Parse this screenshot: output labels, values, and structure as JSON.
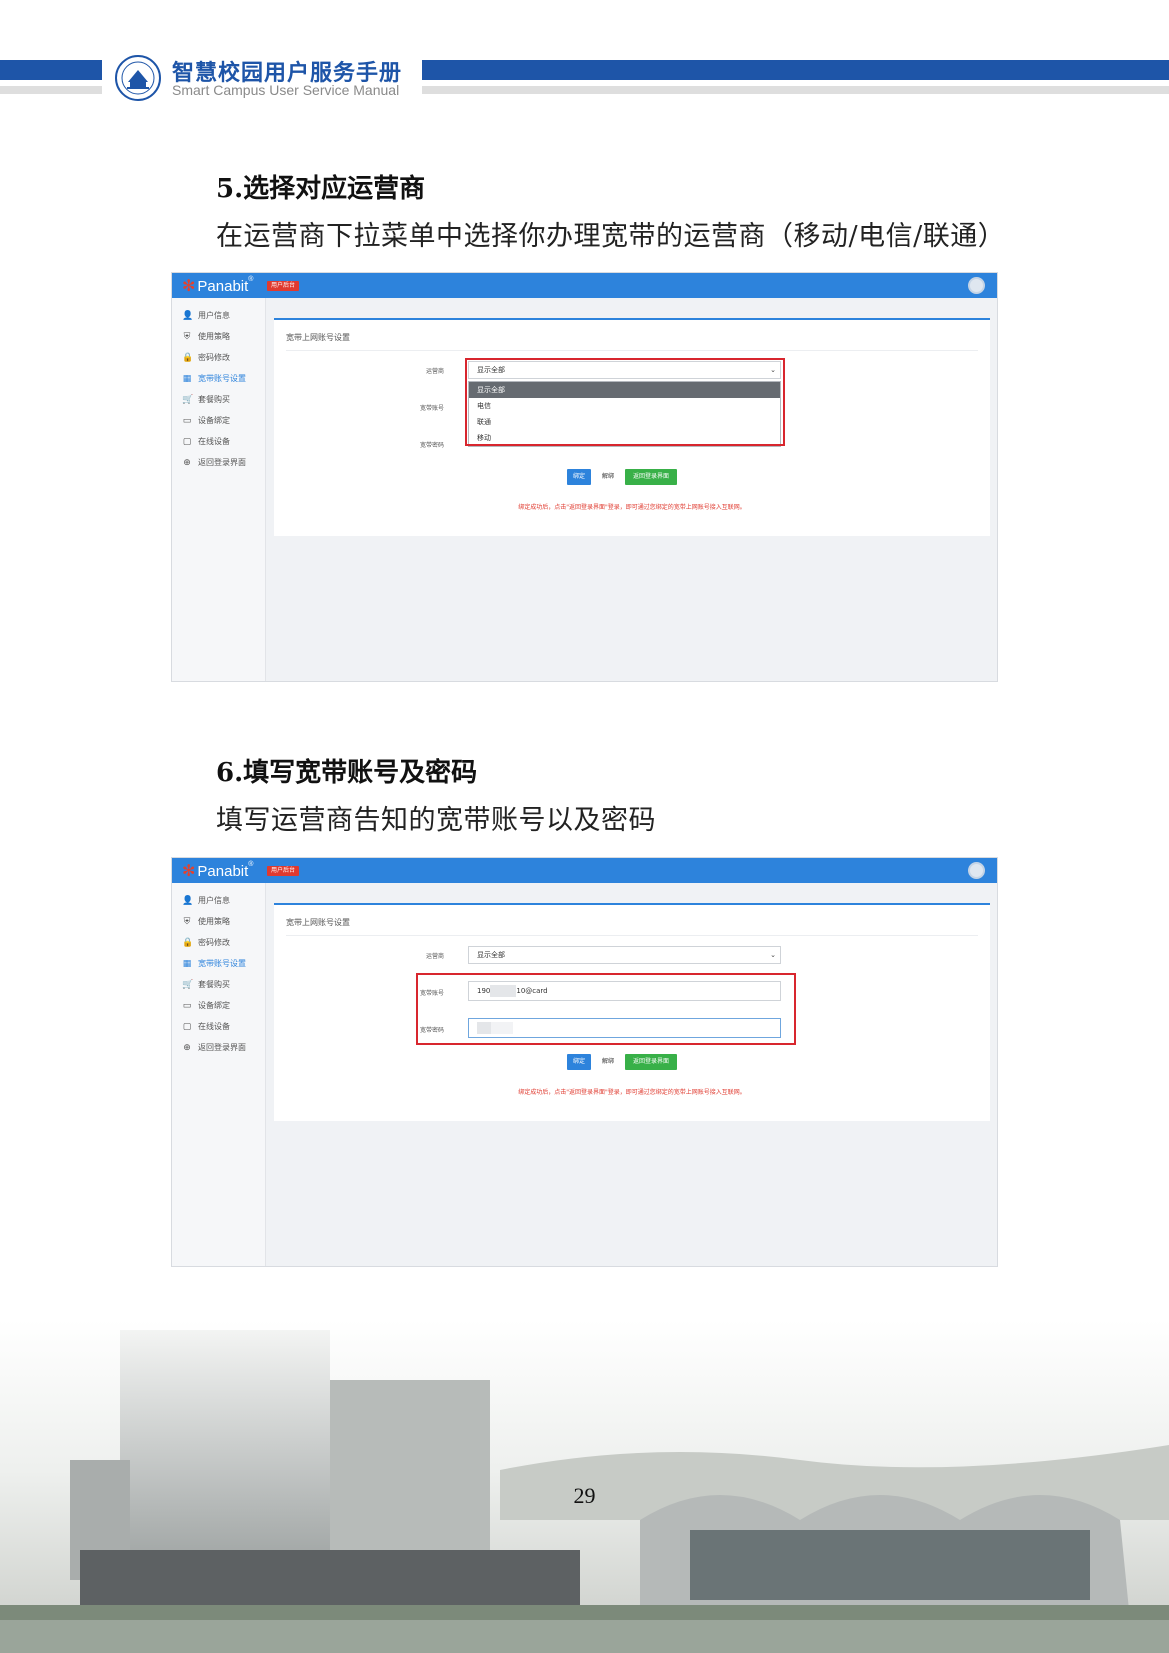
{
  "header": {
    "title": "智慧校园用户服务手册",
    "subtitle": "Smart Campus User Service Manual"
  },
  "section5": {
    "title": "5.选择对应运营商",
    "desc": "在运营商下拉菜单中选择你办理宽带的运营商（移动/电信/联通）"
  },
  "section6": {
    "title": "6.填写宽带账号及密码",
    "desc": "填写运营商告知的宽带账号以及密码"
  },
  "app": {
    "brand": "Panabit",
    "brand_reg": "®",
    "admin_badge": "用户后台",
    "sidebar": [
      {
        "label": "用户信息",
        "icon": "user-icon",
        "active": false
      },
      {
        "label": "使用策略",
        "icon": "shield-icon",
        "active": false
      },
      {
        "label": "密码修改",
        "icon": "lock-icon",
        "active": false
      },
      {
        "label": "宽带账号设置",
        "icon": "card-icon",
        "active": true
      },
      {
        "label": "套餐购买",
        "icon": "cart-icon",
        "active": false
      },
      {
        "label": "设备绑定",
        "icon": "monitor-icon",
        "active": false
      },
      {
        "label": "在线设备",
        "icon": "devices-icon",
        "active": false
      },
      {
        "label": "返回登录界面",
        "icon": "globe-icon",
        "active": false
      }
    ],
    "panel_title": "宽带上网账号设置",
    "operator_label": "运营商",
    "account_label": "宽带账号",
    "password_label": "宽带密码",
    "operator_value": "显示全部",
    "operator_options": [
      "显示全部",
      "电信",
      "联通",
      "移动"
    ],
    "account_prefix": "190",
    "account_suffix": "10@card",
    "btn_bind": "绑定",
    "btn_unbind": "解绑",
    "btn_back": "返回登录界面",
    "note": "绑定成功后，点击\"返回登录界面\"登录，即可通过您绑定的宽带上网账号接入互联网。"
  },
  "page_number": "29",
  "colors": {
    "brand_blue": "#1e55a8",
    "app_blue": "#2d83dc",
    "highlight_red": "#d8262e",
    "back_green": "#38b048"
  }
}
